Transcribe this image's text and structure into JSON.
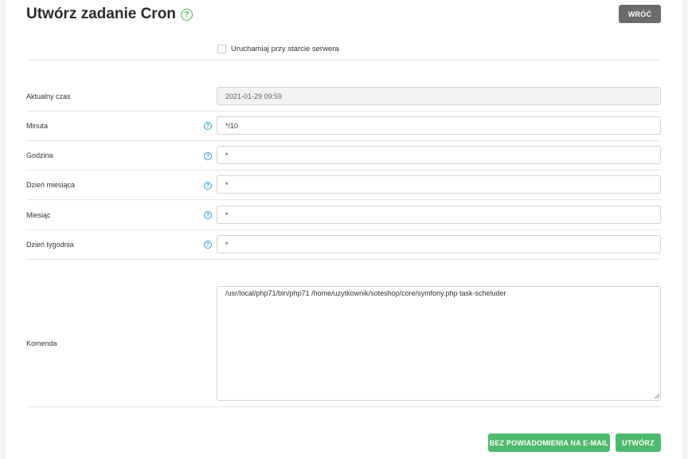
{
  "page": {
    "title": "Utwórz zadanie Cron",
    "back_label": "WRÓĆ"
  },
  "options": {
    "run_on_start_label": "Uruchamiaj przy starcie serwera",
    "run_on_start_checked": false
  },
  "fields": {
    "current_time": {
      "label": "Aktualny czas",
      "value": "2021-01-29 09:59"
    },
    "minute": {
      "label": "Minuta",
      "value": "*/10"
    },
    "hour": {
      "label": "Godzina",
      "value": "*"
    },
    "day_of_month": {
      "label": "Dzień miesiąca",
      "value": "*"
    },
    "month": {
      "label": "Miesiąc",
      "value": "*"
    },
    "day_of_week": {
      "label": "Dzień tygodnia",
      "value": "*"
    },
    "command": {
      "label": "Komenda",
      "value": "/usr/local/php71/bin/php71 /home/uzytkownik/soteshop/core/symfony.php task-scheluder"
    }
  },
  "actions": {
    "no_email_label": "BEZ POWIADOMIENIA NA E-MAIL",
    "create_label": "UTWÓRZ"
  },
  "colors": {
    "accent_green": "#4cba6c",
    "back_gray": "#6b6b6b",
    "help_blue": "#2a9fd6"
  },
  "icons": {
    "title_help": "question-circle-icon",
    "field_help": "question-circle-icon"
  }
}
